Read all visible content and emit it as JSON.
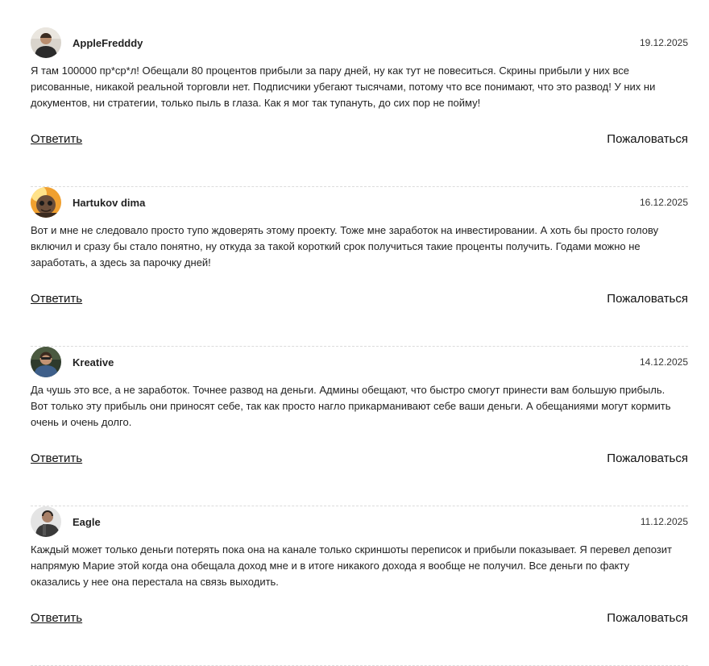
{
  "comments": [
    {
      "author": "AppleFredddy",
      "date": "19.12.2025",
      "text": "Я там 100000 пр*ср*л! Обещали 80 процентов прибыли за пару дней, ну как тут не повеситься. Скрины прибыли у них все рисованные, никакой реальной торговли нет. Подписчики убегают тысячами, потому что все понимают, что это развод! У них ни документов, ни стратегии, только пыль в глаза. Как я мог так тупануть, до сих пор не пойму!",
      "reply_label": "Ответить",
      "report_label": "Пожаловаться"
    },
    {
      "author": "Hartukov dima",
      "date": "16.12.2025",
      "text": "Вот и мне не следовало просто тупо ждоверять этому проекту. Тоже мне заработок на инвестировании. А хоть бы просто голову включил и сразу бы стало понятно, ну откуда за такой короткий срок получиться такие проценты получить. Годами можно не заработать, а здесь за парочку дней!",
      "reply_label": "Ответить",
      "report_label": "Пожаловаться"
    },
    {
      "author": "Kreative",
      "date": "14.12.2025",
      "text": "Да чушь это все, а не заработок. Точнее развод на деньги. Админы обещают, что быстро смогут принести вам большую прибыль. Вот только эту прибыль они приносят себе, так как просто нагло прикарманивают себе ваши деньги. А обещаниями могут кормить очень и очень долго.",
      "reply_label": "Ответить",
      "report_label": "Пожаловаться"
    },
    {
      "author": "Eagle",
      "date": "11.12.2025",
      "text": "Каждый может только деньги потерять пока она на канале только скриншоты переписок и прибыли показывает. Я перевел депозит напрямую Марие этой когда она обещала доход мне и в итоге никакого дохода я вообще не получил. Все деньги по факту оказались у нее она перестала на связь выходить.",
      "reply_label": "Ответить",
      "report_label": "Пожаловаться"
    }
  ]
}
